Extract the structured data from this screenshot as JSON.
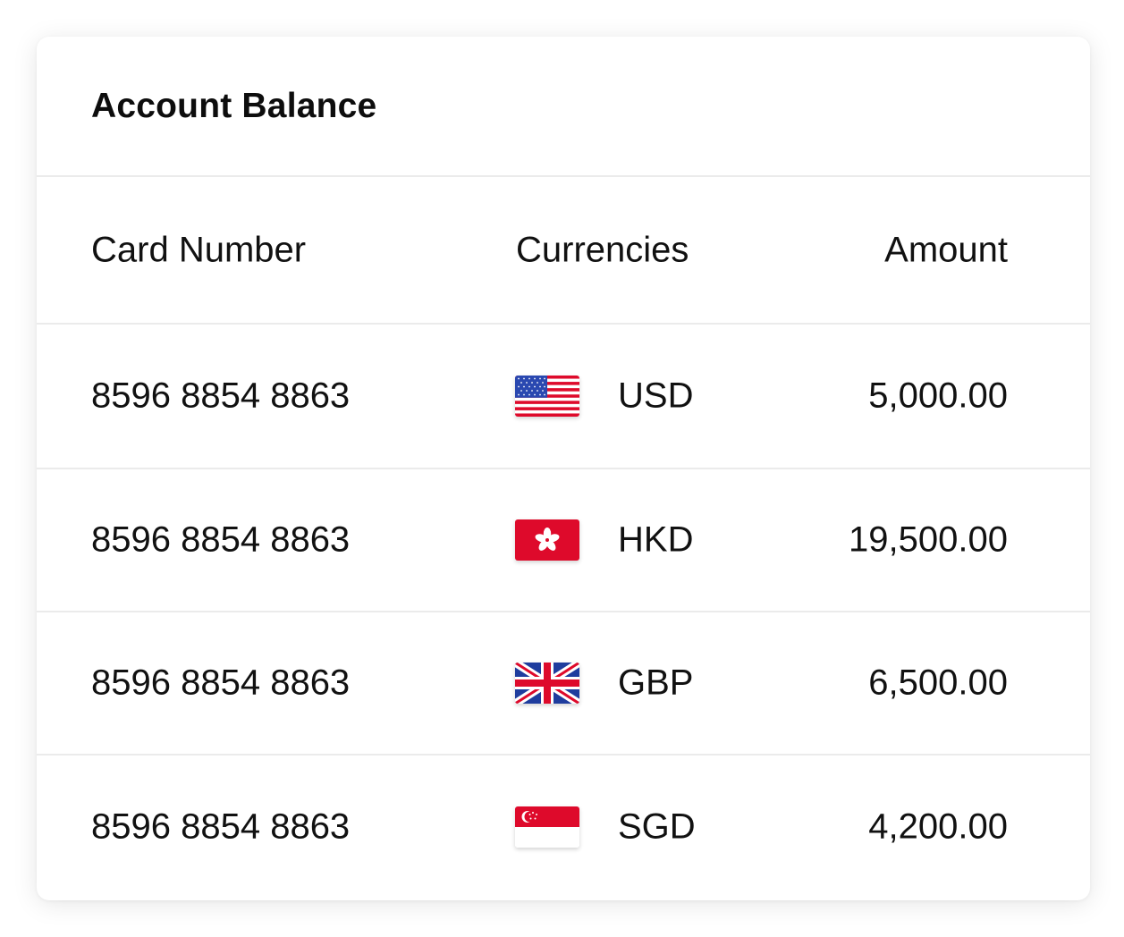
{
  "card": {
    "title": "Account Balance"
  },
  "table": {
    "headers": {
      "card_number": "Card Number",
      "currencies": "Currencies",
      "amount": "Amount"
    },
    "rows": [
      {
        "card_number": "8596 8854 8863",
        "flag_icon": "us-flag-icon",
        "currency": "USD",
        "amount": "5,000.00"
      },
      {
        "card_number": "8596 8854 8863",
        "flag_icon": "hk-flag-icon",
        "currency": "HKD",
        "amount": "19,500.00"
      },
      {
        "card_number": "8596 8854 8863",
        "flag_icon": "uk-flag-icon",
        "currency": "GBP",
        "amount": "6,500.00"
      },
      {
        "card_number": "8596 8854 8863",
        "flag_icon": "sg-flag-icon",
        "currency": "SGD",
        "amount": "4,200.00"
      }
    ]
  },
  "colors": {
    "divider": "#ebebeb",
    "text": "#111111",
    "flag_red": "#de0a2b",
    "flag_blue": "#1f3d9e"
  }
}
